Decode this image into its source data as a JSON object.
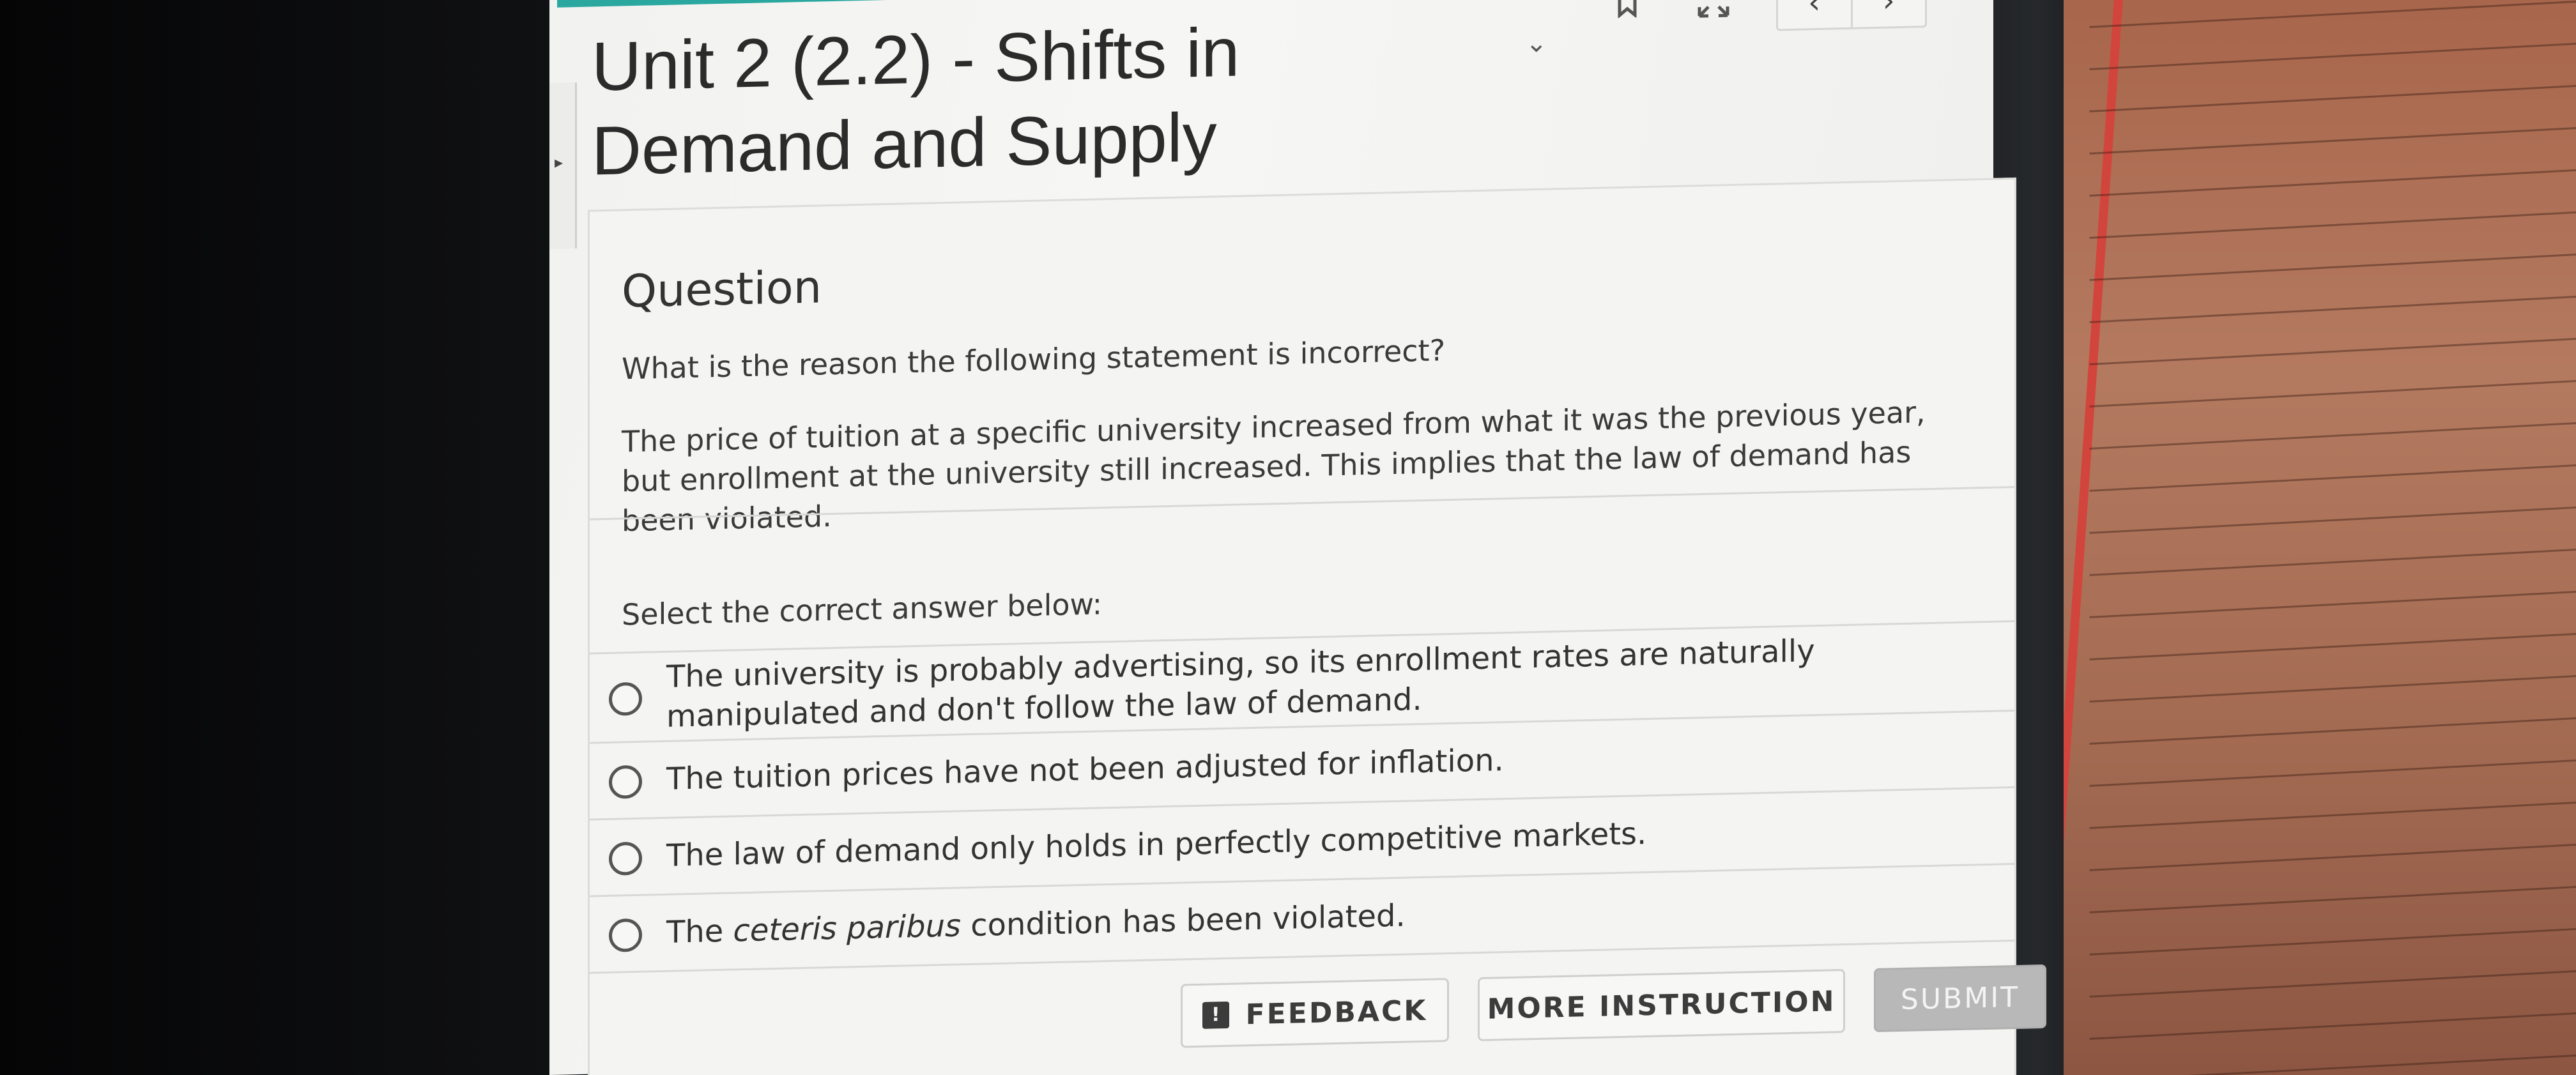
{
  "page": {
    "title_line1": "Unit 2 (2.2) - Shifts in",
    "title_line2": "Demand and Supply"
  },
  "toolbar": {
    "bookmark_icon": "bookmark-icon",
    "expand_icon": "expand-icon",
    "dropdown_icon": "chevron-down-icon",
    "prev_label": "‹",
    "next_label": "›"
  },
  "question": {
    "heading": "Question",
    "prompt": "What is the reason the following statement is incorrect?",
    "statement": "The price of tuition at a specific university increased from what it was the previous year, but enrollment at the university still increased. This implies that the law of demand has been violated.",
    "select_label": "Select the correct answer below:"
  },
  "options": [
    {
      "text": "The university is probably advertising, so its enrollment rates are naturally manipulated and don't follow the law of demand.",
      "selected": false
    },
    {
      "text": "The tuition prices have not been adjusted for inflation.",
      "selected": false
    },
    {
      "text": "The law of demand only holds in perfectly competitive markets.",
      "selected": false
    },
    {
      "text_before": "The ",
      "text_italic": "ceteris paribus",
      "text_after": " condition has been violated.",
      "selected": false
    }
  ],
  "actions": {
    "feedback_label": "FEEDBACK",
    "feedback_icon": "!",
    "more_instruction_label": "MORE INSTRUCTION",
    "submit_label": "SUBMIT"
  },
  "colors": {
    "accent_teal": "#2aa8a0",
    "submit_disabled": "#b8b8b8"
  }
}
